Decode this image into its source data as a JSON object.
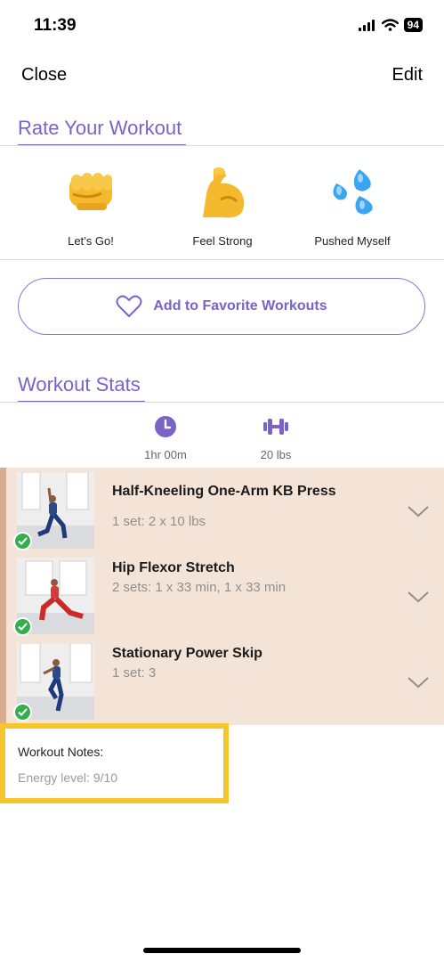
{
  "status_bar": {
    "time": "11:39",
    "battery": "94"
  },
  "nav": {
    "close_label": "Close",
    "edit_label": "Edit"
  },
  "rate_section": {
    "title": "Rate Your Workout",
    "options": [
      {
        "label": "Let’s Go!",
        "icon": "fist-emoji"
      },
      {
        "label": "Feel Strong",
        "icon": "flexed-biceps-emoji"
      },
      {
        "label": "Pushed Myself",
        "icon": "sweat-droplets-emoji"
      }
    ]
  },
  "favorite_button": {
    "label": "Add to Favorite Workouts",
    "icon": "heart-icon"
  },
  "stats_section": {
    "title": "Workout Stats",
    "duration": "1hr 00m",
    "weight": "20 lbs"
  },
  "exercises": [
    {
      "name": "Half-Kneeling One-Arm KB Press",
      "detail": "1 set: 2 x 10 lbs",
      "completed": true
    },
    {
      "name": "Hip Flexor Stretch",
      "detail": "2 sets: 1 x 33 min, 1 x 33 min",
      "completed": true
    },
    {
      "name": "Stationary Power Skip",
      "detail": "1 set: 3",
      "completed": true
    }
  ],
  "notes": {
    "title": "Workout Notes:",
    "value": "Energy level: 9/10"
  },
  "colors": {
    "accent": "#7a62c9",
    "panel": "#f4e4d8",
    "highlight": "#f5c62b",
    "check": "#2fb14d"
  }
}
